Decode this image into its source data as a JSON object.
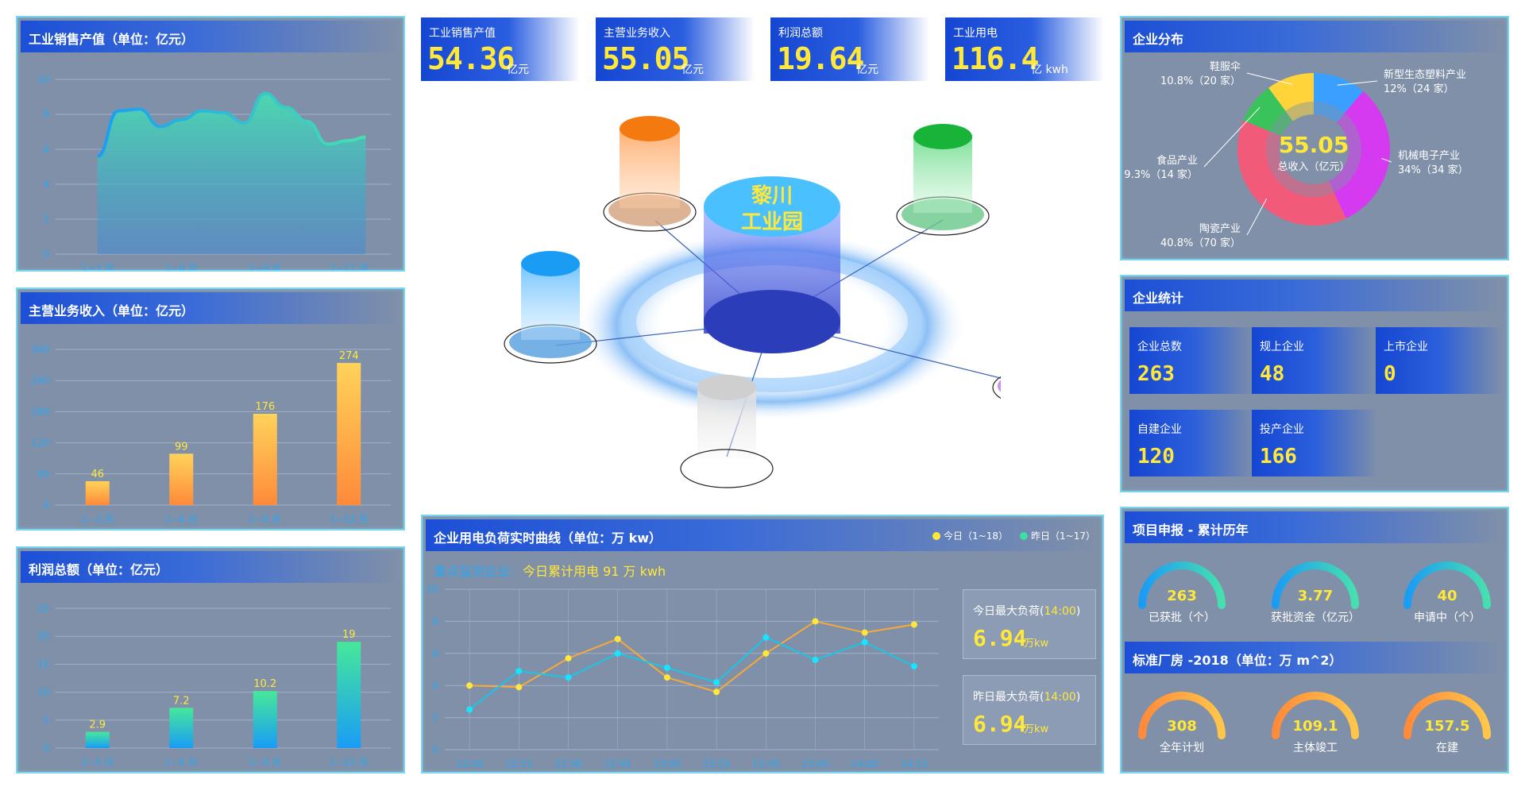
{
  "kpis": [
    {
      "label": "工业销售产值",
      "value": "54.36",
      "unit": "亿元"
    },
    {
      "label": "主营业务收入",
      "value": "55.05",
      "unit": "亿元"
    },
    {
      "label": "利润总额",
      "value": "19.64",
      "unit": "亿元"
    },
    {
      "label": "工业用电",
      "value": "116.4",
      "unit": "亿 kwh"
    }
  ],
  "center": {
    "title_line1": "黎川",
    "title_line2": "工业园",
    "hidden_label": "鞋服伞"
  },
  "panels": {
    "sales": {
      "title": "工业销售产值（单位：亿元）"
    },
    "revenue": {
      "title": "主营业务收入（单位：亿元）"
    },
    "profit": {
      "title": "利润总额（单位：亿元）"
    },
    "power": {
      "title": "企业用电负荷实时曲线（单位：万 kw）"
    },
    "distribution": {
      "title": "企业分布"
    },
    "stats": {
      "title": "企业统计"
    },
    "projects": {
      "title": "项目申报 - 累计历年"
    },
    "factory": {
      "title": "标准厂房 -2018（单位：万 m^2）"
    }
  },
  "power": {
    "subtitle_prefix": "重点监测企业：",
    "subtitle_main": "今日累计用电 91 万 kwh",
    "legend_today": "今日（1~18）",
    "legend_yesterday": "昨日（1~17）",
    "today_max_label": "今日最大负荷(",
    "today_max_time": "14:00",
    "today_max_suffix": ")",
    "today_max_value": "6.94",
    "today_max_unit": "万kw",
    "yesterday_max_label": "昨日最大负荷(",
    "yesterday_max_time": "14:00",
    "yesterday_max_suffix": ")",
    "yesterday_max_value": "6.94",
    "yesterday_max_unit": "万kw"
  },
  "stats": [
    {
      "label": "企业总数",
      "value": "263"
    },
    {
      "label": "规上企业",
      "value": "48"
    },
    {
      "label": "上市企业",
      "value": "0"
    },
    {
      "label": "自建企业",
      "value": "120"
    },
    {
      "label": "投产企业",
      "value": "166"
    }
  ],
  "distribution": {
    "center_value": "55.05",
    "center_label": "总收入（亿元）"
  },
  "projects": [
    {
      "value": "263",
      "label": "已获批（个）"
    },
    {
      "value": "3.77",
      "label": "获批资金（亿元）"
    },
    {
      "value": "40",
      "label": "申请中（个）"
    }
  ],
  "factory": [
    {
      "value": "308",
      "label": "全年计划"
    },
    {
      "value": "109.1",
      "label": "主体竣工"
    },
    {
      "value": "157.5",
      "label": "在建"
    }
  ],
  "colors": {
    "accent_yellow": "#ffe83a",
    "header_blue": "#1c4fd6",
    "panel_bg": "#8090a8",
    "border": "#79d6ee",
    "axis_text": "#2aa8f2"
  },
  "chart_data": [
    {
      "id": "sales",
      "type": "area",
      "categories": [
        "1~3 月",
        "1~6 月",
        "1~9 月",
        "1~12 月"
      ],
      "x": [
        0,
        0.25,
        0.5,
        0.75,
        1.0,
        1.25,
        1.5,
        1.75,
        2.0,
        2.25,
        2.5,
        2.75,
        3.0,
        3.2
      ],
      "values": [
        5.6,
        8.2,
        8.3,
        7.3,
        7.7,
        8.2,
        8.1,
        7.5,
        9.2,
        8.4,
        7.6,
        6.3,
        6.5,
        6.7
      ],
      "yticks": [
        0,
        2,
        4,
        6,
        8,
        10
      ],
      "ylim": [
        0,
        10
      ]
    },
    {
      "id": "revenue",
      "type": "bar",
      "categories": [
        "1~3 月",
        "1~6 月",
        "1~9 月",
        "1~12 月"
      ],
      "values": [
        46,
        99,
        176,
        274
      ],
      "yticks": [
        0,
        60,
        120,
        180,
        240,
        300
      ],
      "ylim": [
        0,
        300
      ]
    },
    {
      "id": "profit",
      "type": "bar",
      "categories": [
        "1~3 月",
        "1~6 月",
        "1~9 月",
        "1~12 月"
      ],
      "values": [
        2.9,
        7.2,
        10.2,
        19
      ],
      "yticks": [
        0,
        5,
        10,
        15,
        20,
        25
      ],
      "ylim": [
        0,
        25
      ]
    },
    {
      "id": "power",
      "type": "line",
      "categories": [
        "12:00",
        "12:15",
        "12:30",
        "12:45",
        "13:00",
        "13:15",
        "13:30",
        "13:45",
        "14:00",
        "14:15"
      ],
      "yticks": [
        0,
        2,
        4,
        6,
        8,
        10
      ],
      "ylim": [
        0,
        10
      ],
      "series": [
        {
          "name": "今日（1~18）",
          "color": "#ffe83a",
          "line": "#f7a93a",
          "values": [
            4.0,
            3.9,
            5.7,
            6.9,
            4.5,
            3.6,
            6.0,
            8.0,
            7.3,
            7.8
          ]
        },
        {
          "name": "昨日（1~17）",
          "color": "#19e3ff",
          "line": "#19c6e8",
          "values": [
            2.5,
            4.9,
            4.5,
            6.0,
            5.1,
            4.2,
            7.0,
            5.6,
            6.7,
            5.2
          ]
        }
      ]
    },
    {
      "id": "distribution",
      "type": "pie",
      "slices": [
        {
          "name": "鞋服伞",
          "label": "10.8%（20 家）",
          "value": 10.8,
          "color": "#ffd43a"
        },
        {
          "name": "新型生态塑料产业",
          "label": "12%（24 家）",
          "value": 12,
          "color": "#3aa0ff"
        },
        {
          "name": "机械电子产业",
          "label": "34%（34 家）",
          "value": 34,
          "color": "#d53af0"
        },
        {
          "name": "陶瓷产业",
          "label": "40.8%（70 家）",
          "value": 40.8,
          "color": "#f25a7a"
        },
        {
          "name": "食品产业",
          "label": "9.3%（14 家）",
          "value": 9.3,
          "color": "#3ac35a"
        }
      ]
    }
  ]
}
